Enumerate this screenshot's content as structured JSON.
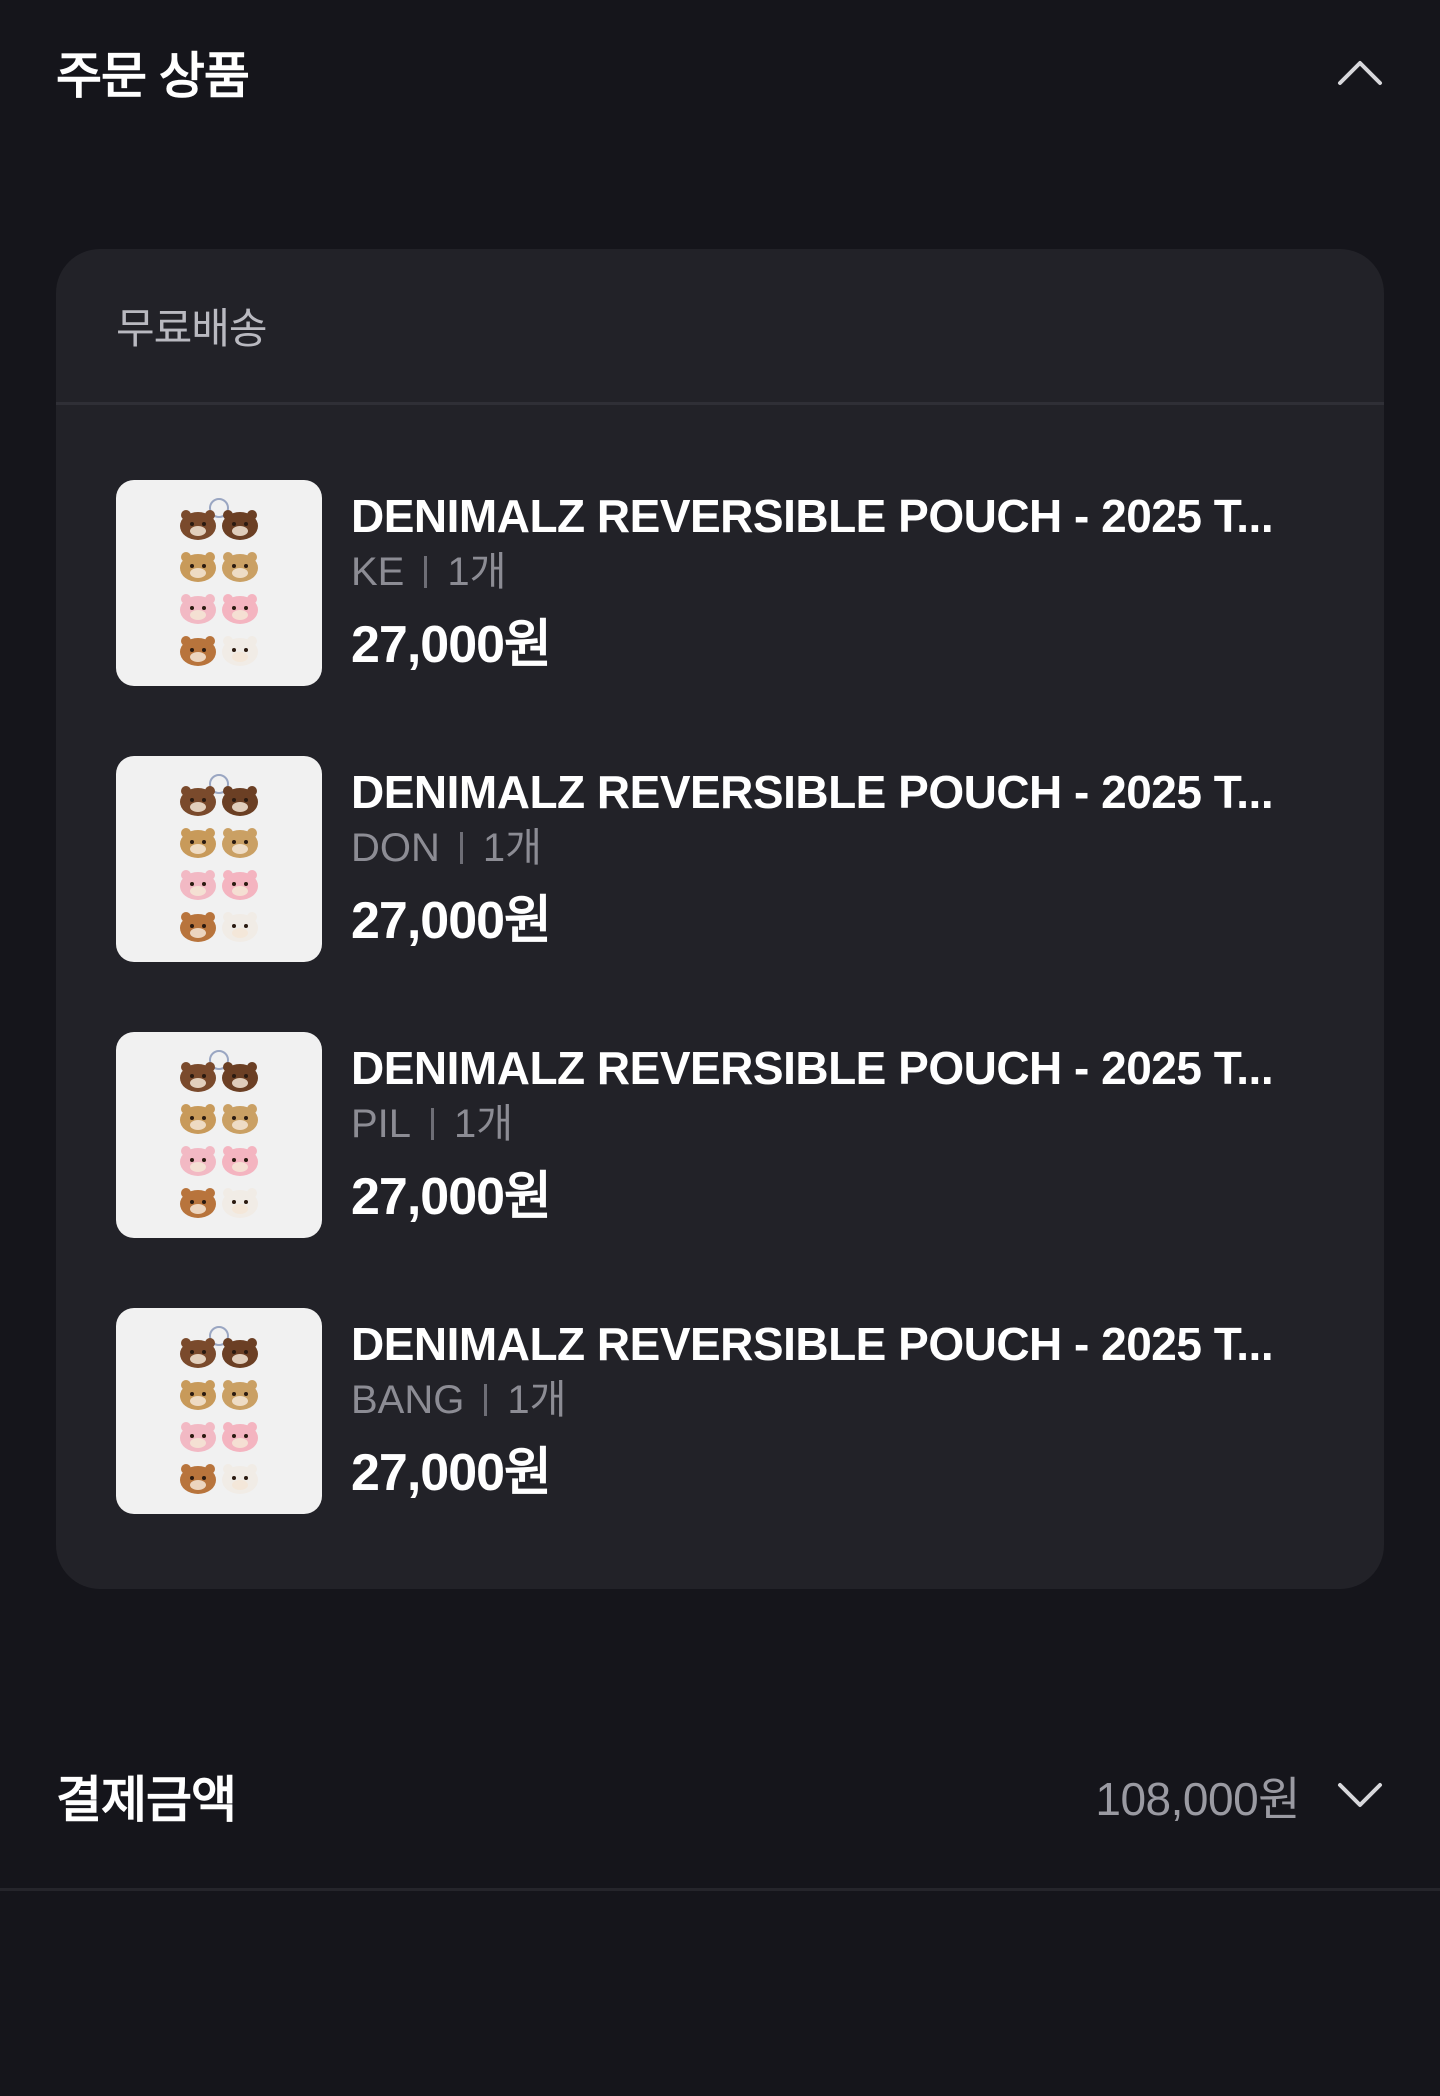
{
  "order_section": {
    "title": "주문 상품",
    "shipping_label": "무료배송",
    "items": [
      {
        "name": "DENIMALZ REVERSIBLE POUCH - 2025 T...",
        "option": "KE",
        "quantity": "1개",
        "price": "27,000원"
      },
      {
        "name": "DENIMALZ REVERSIBLE POUCH - 2025 T...",
        "option": "DON",
        "quantity": "1개",
        "price": "27,000원"
      },
      {
        "name": "DENIMALZ REVERSIBLE POUCH - 2025 T...",
        "option": "PIL",
        "quantity": "1개",
        "price": "27,000원"
      },
      {
        "name": "DENIMALZ REVERSIBLE POUCH - 2025 T...",
        "option": "BANG",
        "quantity": "1개",
        "price": "27,000원"
      }
    ]
  },
  "payment": {
    "title": "결제금액",
    "amount": "108,000원"
  },
  "icons": {
    "collapse": "chevron-up-icon",
    "expand": "chevron-down-icon"
  },
  "colors": {
    "background": "#15151b",
    "card": "#222228",
    "text_primary": "#ffffff",
    "text_secondary": "#8c8c94"
  }
}
